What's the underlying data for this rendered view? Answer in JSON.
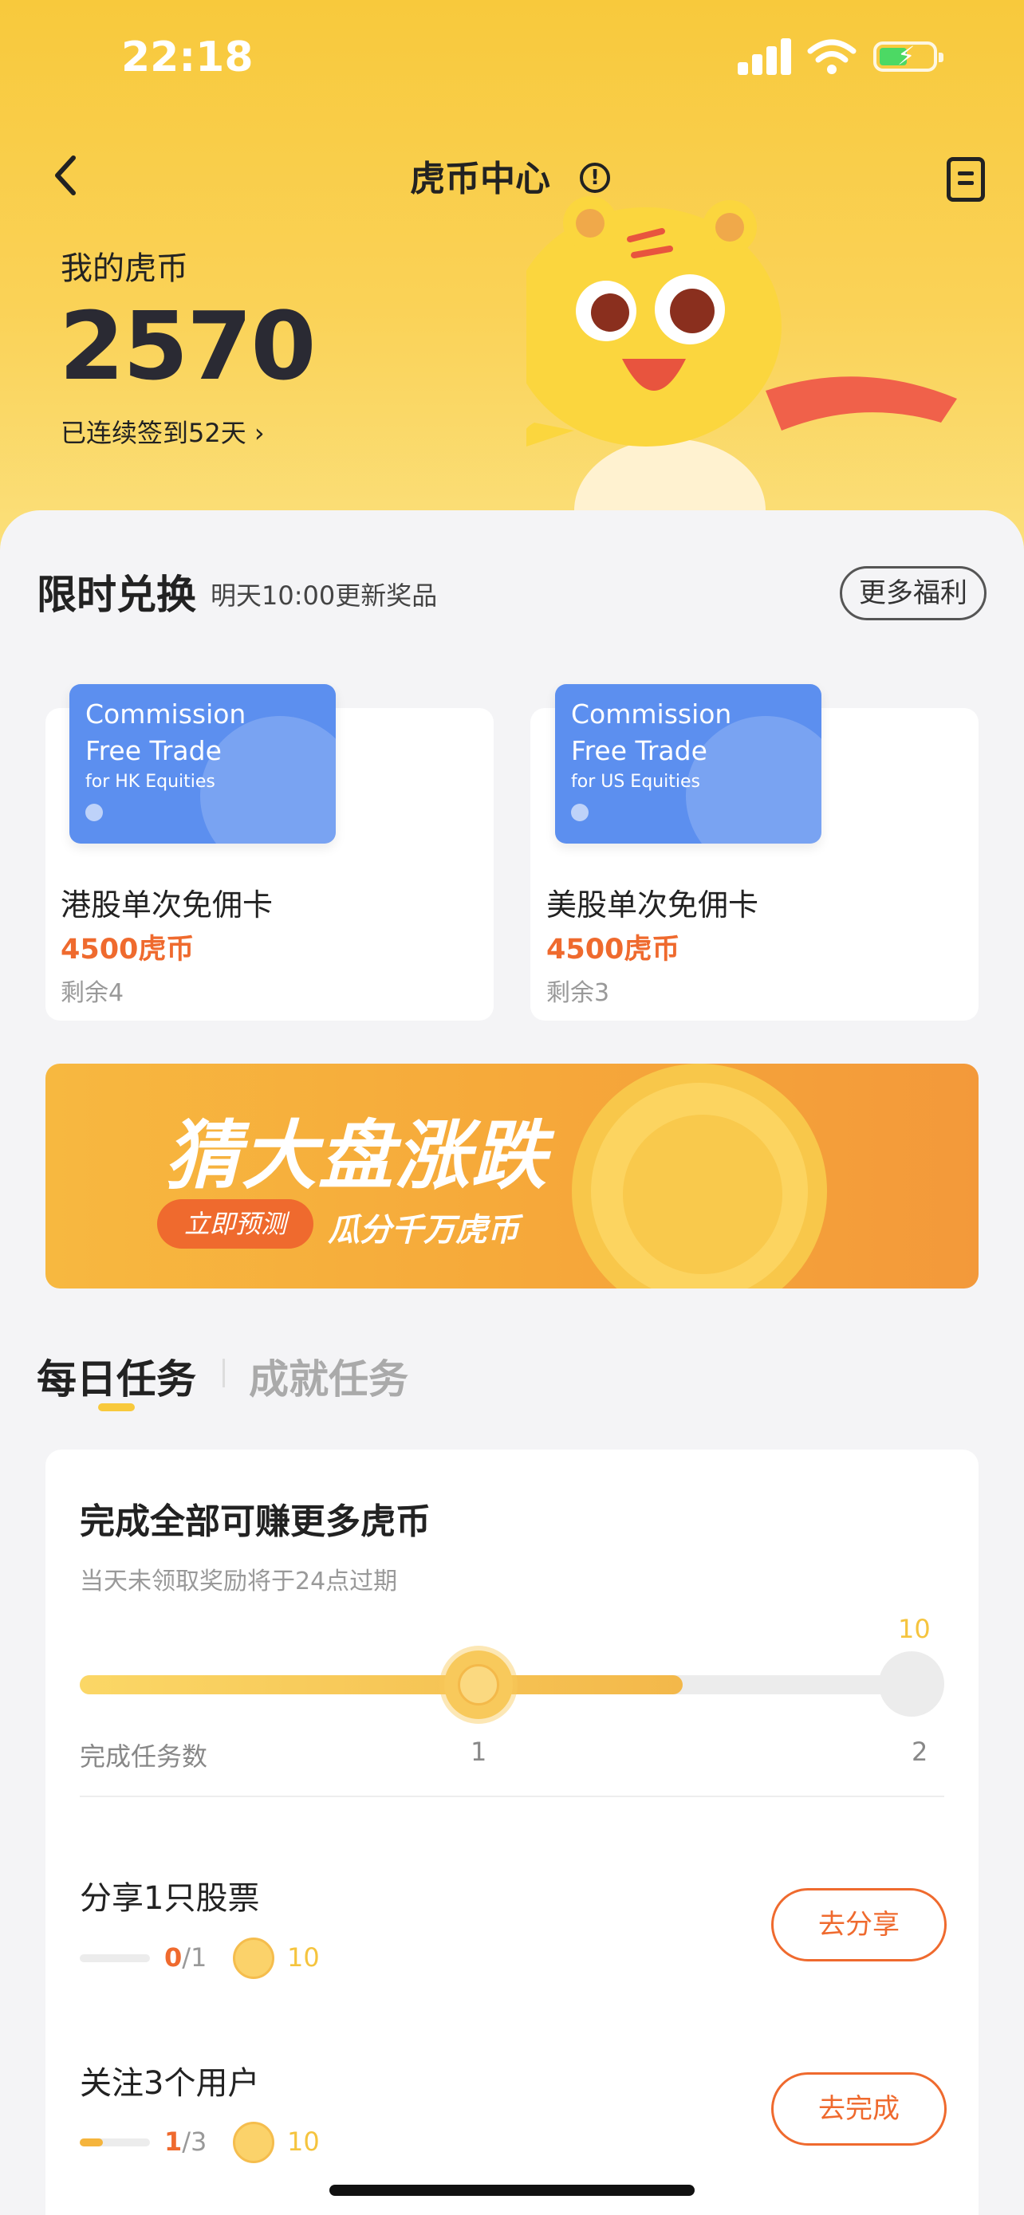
{
  "status_bar": {
    "time": "22:18"
  },
  "header": {
    "title": "虎币中心",
    "info_icon": "info-icon",
    "record_icon": "record-icon"
  },
  "balance": {
    "label": "我的虎币",
    "value": "2570",
    "checkin": "已连续签到52天 ›"
  },
  "exchange": {
    "title": "限时兑换",
    "subtitle": "明天10:00更新奖品",
    "more_label": "更多福利",
    "items": [
      {
        "card_line1": "Commission",
        "card_line2": "Free Trade",
        "card_line3": "for HK Equities",
        "name": "港股单次免佣卡",
        "price": "4500虎币",
        "remaining": "剩余4"
      },
      {
        "card_line1": "Commission",
        "card_line2": "Free Trade",
        "card_line3": "for US Equities",
        "name": "美股单次免佣卡",
        "price": "4500虎币",
        "remaining": "剩余3"
      }
    ]
  },
  "banner": {
    "title": "猜大盘涨跌",
    "button": "立即预测",
    "subtitle": "瓜分千万虎币"
  },
  "tabs": [
    {
      "label": "每日任务",
      "active": true
    },
    {
      "label": "成就任务",
      "active": false
    }
  ],
  "daily": {
    "title": "完成全部可赚更多虎币",
    "note": "当天未领取奖励将于24点过期",
    "progress_fraction": 0.7,
    "end_reward": "10",
    "axis_label": "完成任务数",
    "tick1": "1",
    "tick2": "2",
    "tasks": [
      {
        "name": "分享1只股票",
        "done": "0",
        "total": "/1",
        "progress": 0,
        "reward": "10",
        "button": "去分享"
      },
      {
        "name": "关注3个用户",
        "done": "1",
        "total": "/3",
        "progress": 0.333,
        "reward": "10",
        "button": "去完成"
      }
    ]
  },
  "colors": {
    "brand_yellow": "#f8c93c",
    "accent_orange": "#ef6a2e",
    "voucher_blue": "#5c8fef"
  }
}
